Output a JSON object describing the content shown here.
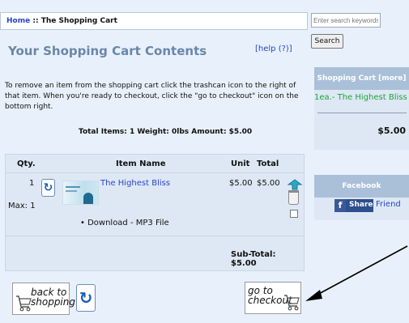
{
  "breadcrumb": {
    "home": "Home",
    "separator": "::",
    "current": "The Shopping Cart"
  },
  "heading": "Your Shopping Cart Contents",
  "help_link": "[help (?)]",
  "intro": "To remove an item from the shopping cart click the trashcan icon to the right of that item. When you're ready to checkout, click the \"go to checkout\" icon on the bottom right.",
  "totals_line": "Total Items: 1  Weight: 0lbs  Amount: $5.00",
  "table": {
    "headers": {
      "qty": "Qty.",
      "item": "Item Name",
      "unit": "Unit",
      "total": "Total"
    },
    "rows": [
      {
        "qty": "1",
        "max": "Max: 1",
        "name": "The Highest Bliss",
        "unit": "$5.00",
        "total": "$5.00",
        "attribute": "• Download - MP3 File"
      }
    ],
    "subtotal": "Sub-Total: $5.00"
  },
  "buttons": {
    "back_line1": "back to",
    "back_line2": "shopping",
    "checkout_line1": "go to",
    "checkout_line2": "checkout"
  },
  "sidebar": {
    "search_placeholder": "Enter search keywords here",
    "search_button": "Search",
    "cart_box": {
      "title": "Shopping Cart  [more]",
      "item": "1ea.- The Highest Bliss",
      "total": "$5.00"
    },
    "facebook": {
      "title": "Facebook",
      "share": "Share",
      "friend": "Friend"
    }
  },
  "colors": {
    "link": "#2a44c8",
    "accent": "#aac0d9",
    "cart_item": "#1da33a"
  },
  "icons": [
    "update-cycle-icon",
    "trash-icon",
    "shopping-cart-icon",
    "facebook-f-icon",
    "annotation-arrow"
  ]
}
